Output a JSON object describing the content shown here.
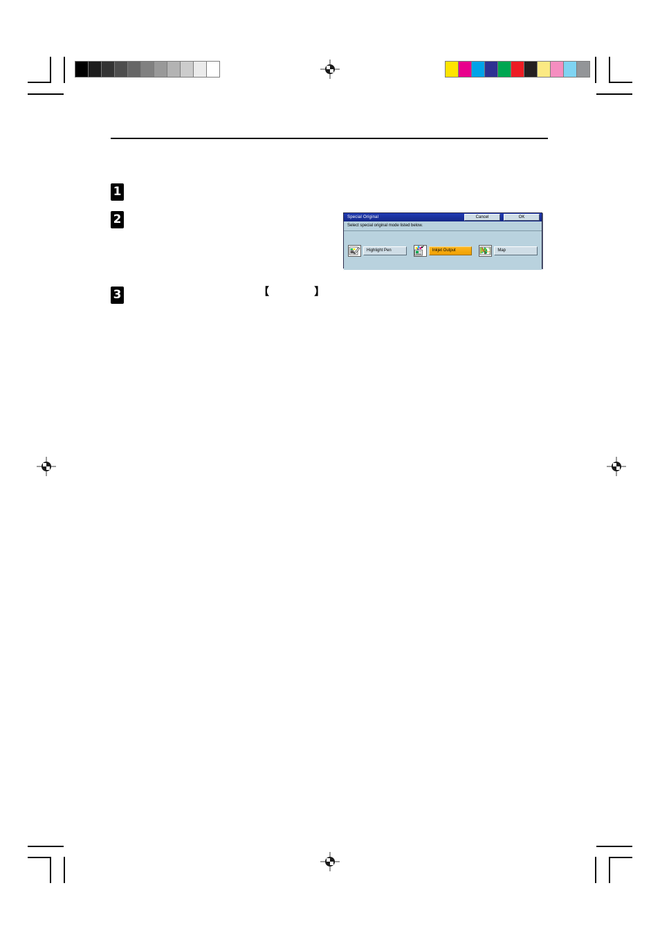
{
  "page": {
    "grayscale_strip": {
      "name": "grayscale-calibration-strip",
      "patches": [
        "#000000",
        "#1c1c1c",
        "#333333",
        "#4d4d4d",
        "#666666",
        "#808080",
        "#999999",
        "#b3b3b3",
        "#cccccc",
        "#ebebeb",
        "#ffffff"
      ]
    },
    "color_strip": {
      "name": "color-calibration-strip",
      "patches": [
        "#ffe400",
        "#e8008c",
        "#00a3e8",
        "#2e3192",
        "#00a651",
        "#ed1c24",
        "#231f20",
        "#fbe983",
        "#f58ec0",
        "#7fd4f2",
        "#939598"
      ]
    },
    "steps": [
      {
        "number": "1"
      },
      {
        "number": "2"
      },
      {
        "number": "3"
      }
    ],
    "bracket_text": "【 】"
  },
  "dialog": {
    "title": "Special Original",
    "instruction": "Select special original mode listed below.",
    "buttons": {
      "cancel_label": "Cancel",
      "ok_label": "OK"
    },
    "modes": [
      {
        "label": "Highlight Pen",
        "icon": "highlight-pen-icon",
        "selected": false
      },
      {
        "label": "Inkjet Output",
        "icon": "inkjet-output-icon",
        "selected": true
      },
      {
        "label": "Map",
        "icon": "map-icon",
        "selected": false
      }
    ],
    "colors": {
      "titlebar": "#1c2e9e",
      "body": "#b9d2de",
      "selected_accent": "#f5a800"
    }
  }
}
